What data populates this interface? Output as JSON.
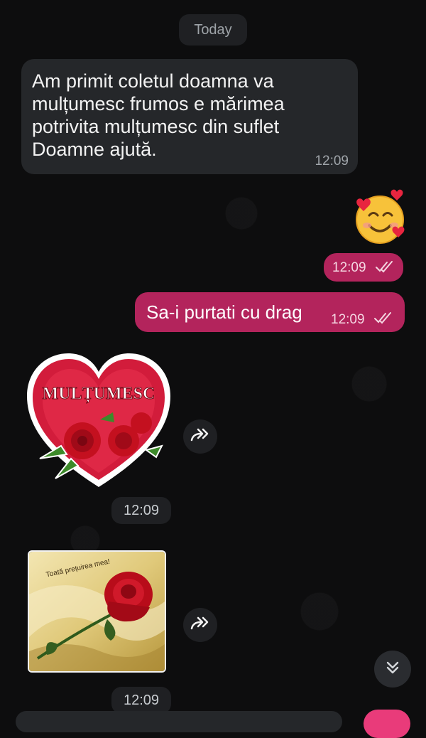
{
  "chat": {
    "date_divider": "Today",
    "incoming_text": "Am primit coletul doamna va mulțumesc frumos e mărimea potrivita mulțumesc  din suflet Doamne ajută.",
    "incoming_time": "12:09",
    "emoji_time": "12:09",
    "outgoing_text": "Sa-i purtati cu drag",
    "outgoing_time": "12:09",
    "sticker_text": "MULȚUMESC",
    "sticker_time": "12:09",
    "photo_caption": "Toată prețuirea mea!",
    "photo_time": "12:09"
  },
  "colors": {
    "background": "#0d0d0e",
    "incoming_bubble": "#25272a",
    "outgoing_bubble": "#b3245c",
    "accent": "#e93b7a"
  },
  "icons": {
    "read_receipt": "double-check-icon",
    "forward": "forward-icon",
    "scroll_down": "double-chevron-down-icon"
  }
}
